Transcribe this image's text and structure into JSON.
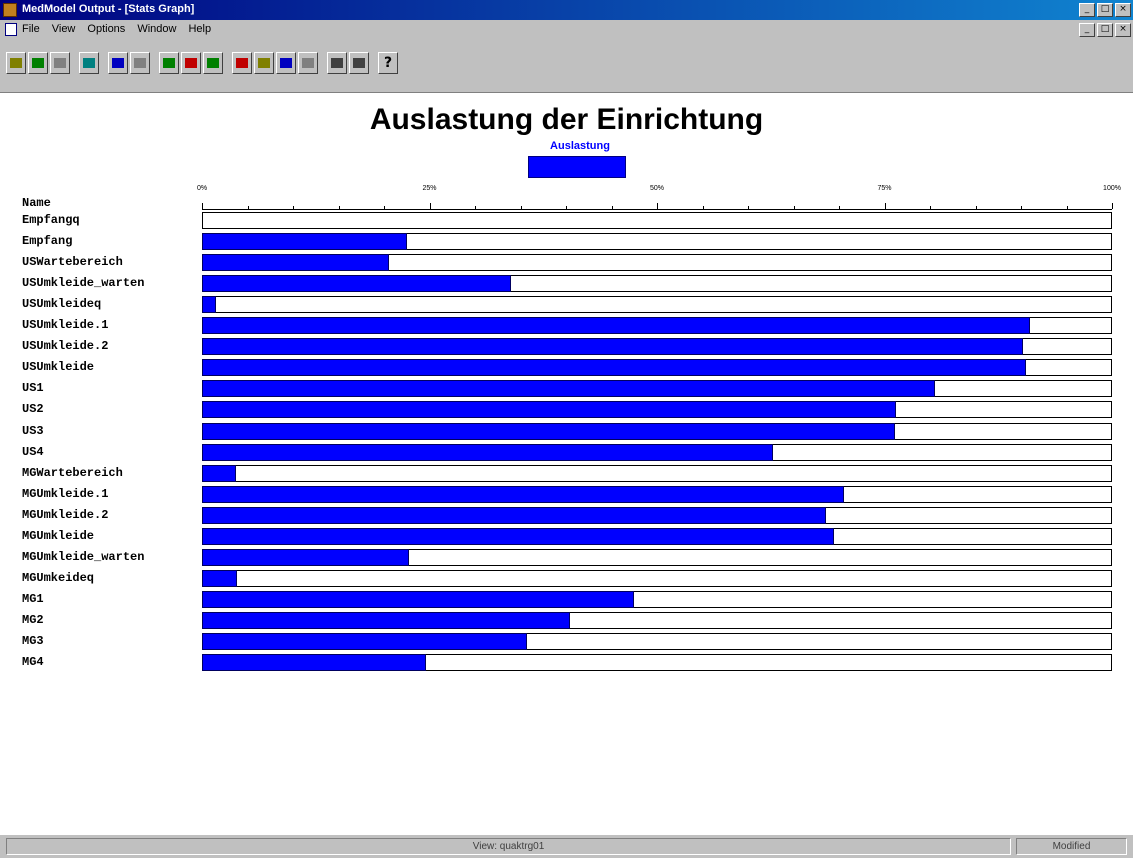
{
  "window": {
    "title": "MedModel Output - [Stats Graph]",
    "buttons": [
      "minimize-icon",
      "maximize-icon",
      "close-icon"
    ]
  },
  "menu": {
    "items": [
      "File",
      "View",
      "Options",
      "Window",
      "Help"
    ]
  },
  "toolbar": {
    "buttons": [
      {
        "name": "open-icon",
        "color": "#808000"
      },
      {
        "name": "print-setup-icon",
        "color": "#008000"
      },
      {
        "name": "save-icon",
        "color": "#808080"
      },
      {
        "name": "fit-icon",
        "color": "#008080"
      },
      {
        "name": "report-icon",
        "color": "#0000c0"
      },
      {
        "name": "table-icon",
        "color": "#808080"
      },
      {
        "name": "bar-graph-icon",
        "color": "#008000"
      },
      {
        "name": "chart-icon",
        "color": "#c00000"
      },
      {
        "name": "pie-icon",
        "color": "#008000"
      },
      {
        "name": "graph-icon",
        "color": "#c00000"
      },
      {
        "name": "edit-icon",
        "color": "#808000"
      },
      {
        "name": "color-icon",
        "color": "#0000c0"
      },
      {
        "name": "layout-icon",
        "color": "#808080"
      },
      {
        "name": "print-icon",
        "color": "#404040"
      },
      {
        "name": "preview-icon",
        "color": "#404040"
      },
      {
        "name": "help-icon",
        "color": "#000000",
        "glyph": "?"
      }
    ]
  },
  "chart_data": {
    "type": "bar",
    "orientation": "horizontal",
    "title": "Auslastung der Einrichtung",
    "legend": {
      "label": "Auslastung",
      "color": "#0000ff",
      "placement": "top-center"
    },
    "category_header": "Name",
    "xlim": [
      0,
      100
    ],
    "ticks": [
      "0%",
      "25%",
      "50%",
      "75%",
      "100%"
    ],
    "minor_ticks_per_major": 5,
    "track_color": "#ffffff",
    "series": [
      {
        "name": "Auslastung",
        "color": "#0000ff"
      }
    ],
    "categories": [
      "Empfangq",
      "Empfang",
      "USWartebereich",
      "USUmkleide_warten",
      "USUmkleideq",
      "USUmkleide.1",
      "USUmkleide.2",
      "USUmkleide",
      "US1",
      "US2",
      "US3",
      "US4",
      "MGWartebereich",
      "MGUmkleide.1",
      "MGUmkleide.2",
      "MGUmkleide",
      "MGUmkleide_warten",
      "MGUmkeideq",
      "MG1",
      "MG2",
      "MG3",
      "MG4"
    ],
    "values": [
      0,
      22.5,
      20.5,
      34,
      1.5,
      91,
      90.2,
      90.6,
      80.5,
      76.3,
      76.2,
      62.7,
      3.7,
      70.5,
      68.6,
      69.5,
      22.8,
      3.8,
      47.5,
      40.4,
      35.7,
      24.6
    ]
  },
  "status": {
    "view": "View:  quaktrg01",
    "state": "Modified"
  }
}
